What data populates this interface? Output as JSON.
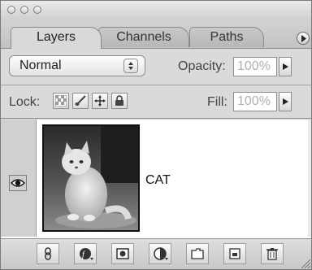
{
  "window": {
    "buttons": [
      "close",
      "minimize",
      "zoom"
    ]
  },
  "tabs": [
    {
      "label": "Layers",
      "active": true
    },
    {
      "label": "Channels",
      "active": false
    },
    {
      "label": "Paths",
      "active": false
    }
  ],
  "blend": {
    "mode": "Normal",
    "opacity_label": "Opacity:",
    "opacity_value": "100%"
  },
  "lock": {
    "label": "Lock:",
    "fill_label": "Fill:",
    "fill_value": "100%",
    "icons": [
      "transparency-lock-icon",
      "brush-lock-icon",
      "move-lock-icon",
      "padlock-icon"
    ]
  },
  "layers": [
    {
      "name": "CAT",
      "visible": true
    }
  ],
  "toolbar": {
    "icons": [
      "link-icon",
      "fx-icon",
      "mask-icon",
      "adjustment-icon",
      "folder-icon",
      "new-layer-icon",
      "trash-icon"
    ]
  },
  "colors": {
    "panel": "#d6d6d6",
    "list": "#ffffff"
  }
}
